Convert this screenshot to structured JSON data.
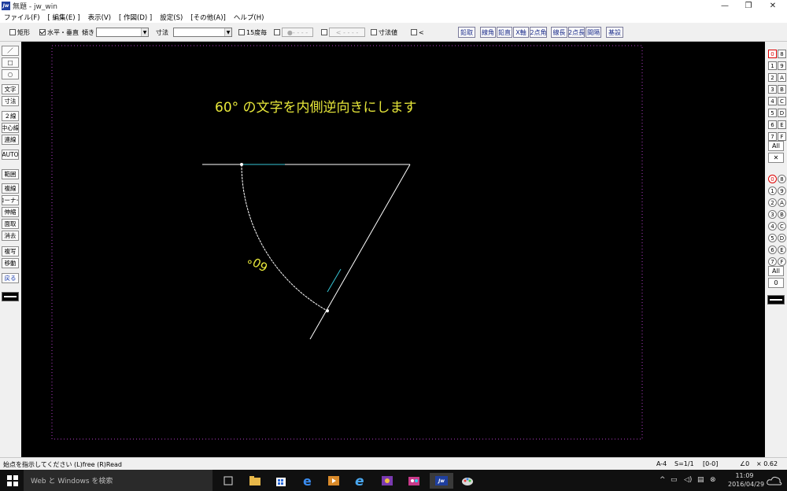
{
  "window": {
    "title": "無題 - jw_win",
    "app_icon": "Jw",
    "min_label": "—",
    "max_label": "❐",
    "close_label": "✕"
  },
  "menu": [
    "ファイル(F)",
    "[ 編集(E) ]",
    "表示(V)",
    "[ 作図(D) ]",
    "設定(S)",
    "[その他(A)]",
    "ヘルプ(H)"
  ],
  "toolbar": {
    "rect_label": "矩形",
    "hv_label": "水平・垂直",
    "tilt_label": "傾き",
    "dim_label": "寸法",
    "deg15_label": "15度毎",
    "dim_value_label": "寸法値",
    "lt_label": "<",
    "dis1": "●- - - -",
    "dis2": "< - - - -",
    "right_buttons": [
      "鉛取",
      "線角",
      "鉛直",
      "X軸",
      "2点角",
      "線長",
      "2点長",
      "間隔",
      "基設"
    ]
  },
  "left_tools": [
    "／",
    "□",
    "○",
    "文字",
    "寸法",
    "２線",
    "中心線",
    "連線",
    "AUTO",
    "範囲",
    "複線",
    "コーナー",
    "伸縮",
    "面取",
    "消去",
    "複写",
    "移動",
    "戻る"
  ],
  "layers": {
    "group_top": [
      [
        "0",
        "8"
      ],
      [
        "1",
        "9"
      ],
      [
        "2",
        "A"
      ],
      [
        "3",
        "B"
      ],
      [
        "4",
        "C"
      ],
      [
        "5",
        "D"
      ],
      [
        "6",
        "E"
      ],
      [
        "7",
        "F"
      ]
    ],
    "all_label": "All",
    "x_label": "✕",
    "group_bottom": [
      [
        "0",
        "8"
      ],
      [
        "1",
        "9"
      ],
      [
        "2",
        "A"
      ],
      [
        "3",
        "B"
      ],
      [
        "4",
        "C"
      ],
      [
        "5",
        "D"
      ],
      [
        "6",
        "E"
      ],
      [
        "7",
        "F"
      ]
    ],
    "all2_label": "All",
    "zero_label": "0"
  },
  "canvas": {
    "heading": "60° の文字を内側逆向きにします",
    "arc_label": "60°",
    "colors": {
      "bg": "#000000",
      "line": "#ffffff",
      "text": "#e8e83a",
      "accent": "#36c6d6",
      "border": "#b43cc8"
    }
  },
  "status": {
    "message": "始点を指示してください (L)free (R)Read",
    "paper": "A-4",
    "scale": "S=1/1",
    "layer": "[0-0]",
    "angle": "∠0",
    "zoom": "× 0.62"
  },
  "taskbar": {
    "search_placeholder": "Web と Windows を検索",
    "time": "11:09",
    "date": "2016/04/29",
    "icons": [
      "start-icon",
      "task-view-icon",
      "file-explorer-icon",
      "store-icon",
      "edge-icon",
      "media-icon",
      "ie-icon",
      "photo-app-icon",
      "game-icon",
      "jw-cad-icon",
      "paint-icon"
    ],
    "tray_up": "^"
  }
}
